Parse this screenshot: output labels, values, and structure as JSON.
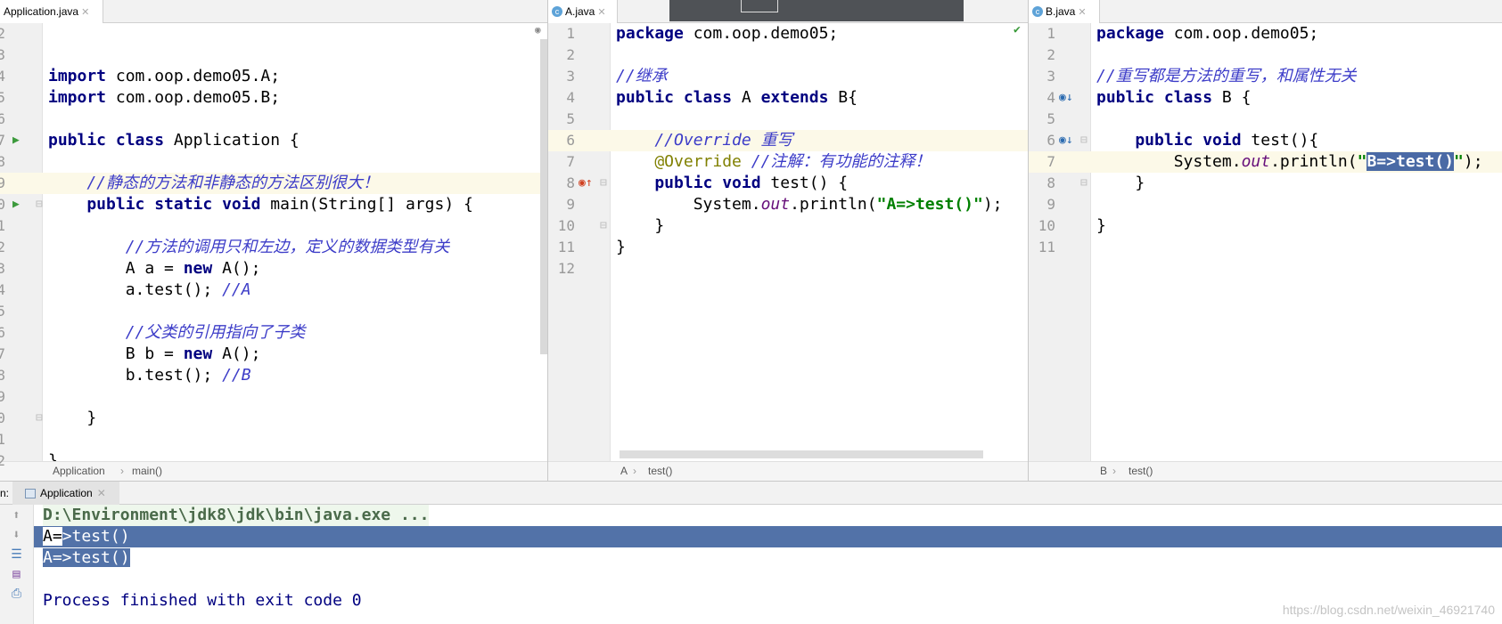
{
  "left": {
    "tab": "Application.java",
    "breadcrumb": [
      "Application",
      "main()"
    ],
    "first_line": 2,
    "lines": [
      [],
      [],
      [
        [
          "import ",
          "kw"
        ],
        [
          "com.oop.demo05.A;",
          ""
        ]
      ],
      [
        [
          "import ",
          "kw"
        ],
        [
          "com.oop.demo05.B;",
          ""
        ]
      ],
      [],
      [
        [
          "public class ",
          "kw"
        ],
        [
          "Application {",
          ""
        ]
      ],
      [],
      [
        [
          "    //静态的方法和非静态的方法区别很大！",
          "cm"
        ]
      ],
      [
        [
          "    public static void ",
          "kw"
        ],
        [
          "main(String[] args) {",
          ""
        ]
      ],
      [],
      [
        [
          "        //方法的调用只和左边，定义的数据类型有关",
          "cm"
        ]
      ],
      [
        [
          "        A a = ",
          ""
        ],
        [
          "new ",
          "kw"
        ],
        [
          "A();",
          ""
        ]
      ],
      [
        [
          "        a.test(); ",
          ""
        ],
        [
          "//A",
          "cm"
        ]
      ],
      [],
      [
        [
          "        //父类的引用指向了子类",
          "cm"
        ]
      ],
      [
        [
          "        B b = ",
          ""
        ],
        [
          "new ",
          "kw"
        ],
        [
          "A();",
          ""
        ]
      ],
      [
        [
          "        b.test(); ",
          ""
        ],
        [
          "//B",
          "cm"
        ]
      ],
      [],
      [
        [
          "    }",
          ""
        ]
      ],
      [],
      [
        [
          "}",
          ""
        ]
      ]
    ],
    "current": 7
  },
  "middle": {
    "tab": "A.java",
    "breadcrumb": [
      "A",
      "test()"
    ],
    "first_line": 1,
    "lines": [
      [
        [
          "package ",
          "kw"
        ],
        [
          "com.oop.demo05;",
          ""
        ]
      ],
      [],
      [
        [
          "//继承",
          "cm"
        ]
      ],
      [
        [
          "public class ",
          "kw"
        ],
        [
          "A ",
          ""
        ],
        [
          "extends ",
          "kw"
        ],
        [
          "B{",
          ""
        ]
      ],
      [],
      [
        [
          "    //Override 重写",
          "cm"
        ]
      ],
      [
        [
          "    @Override ",
          "an"
        ],
        [
          "//注解：有功能的注释！",
          "cm"
        ]
      ],
      [
        [
          "    public void ",
          "kw"
        ],
        [
          "test() {",
          ""
        ]
      ],
      [
        [
          "        System.",
          ""
        ],
        [
          "out",
          "fd"
        ],
        [
          ".println(",
          ""
        ],
        [
          "\"A=>test()\"",
          "st"
        ],
        [
          ");",
          ""
        ]
      ],
      [
        [
          "    }",
          ""
        ]
      ],
      [
        [
          "}",
          ""
        ]
      ],
      []
    ],
    "current": 5
  },
  "right": {
    "tab": "B.java",
    "breadcrumb": [
      "B",
      "test()"
    ],
    "first_line": 1,
    "lines": [
      [
        [
          "package ",
          "kw"
        ],
        [
          "com.oop.demo05;",
          ""
        ]
      ],
      [],
      [
        [
          "//重写都是方法的重写，和属性无关",
          "cm"
        ]
      ],
      [
        [
          "public class ",
          "kw"
        ],
        [
          "B {",
          ""
        ]
      ],
      [],
      [
        [
          "    public void ",
          "kw"
        ],
        [
          "test(){",
          ""
        ]
      ],
      [
        [
          "        System.",
          ""
        ],
        [
          "out",
          "fd"
        ],
        [
          ".println(",
          ""
        ],
        [
          "\"",
          "st"
        ],
        [
          "B=>test()",
          "st sel"
        ],
        [
          "\"",
          "st"
        ],
        [
          ");",
          ""
        ]
      ],
      [
        [
          "    }",
          ""
        ]
      ],
      [],
      [
        [
          "}",
          ""
        ]
      ],
      []
    ],
    "current": 6
  },
  "run": {
    "label": "n:",
    "tab": "Application",
    "console": [
      "D:\\Environment\\jdk8\\jdk\\bin\\java.exe ...",
      "A=>test()",
      "A=>test()",
      "",
      "Process finished with exit code 0"
    ]
  },
  "watermark": "https://blog.csdn.net/weixin_46921740",
  "colors": {
    "keyword": "#000080",
    "comment": "#3c3cc8",
    "string": "#008000",
    "selection": "#4a6aa5"
  }
}
